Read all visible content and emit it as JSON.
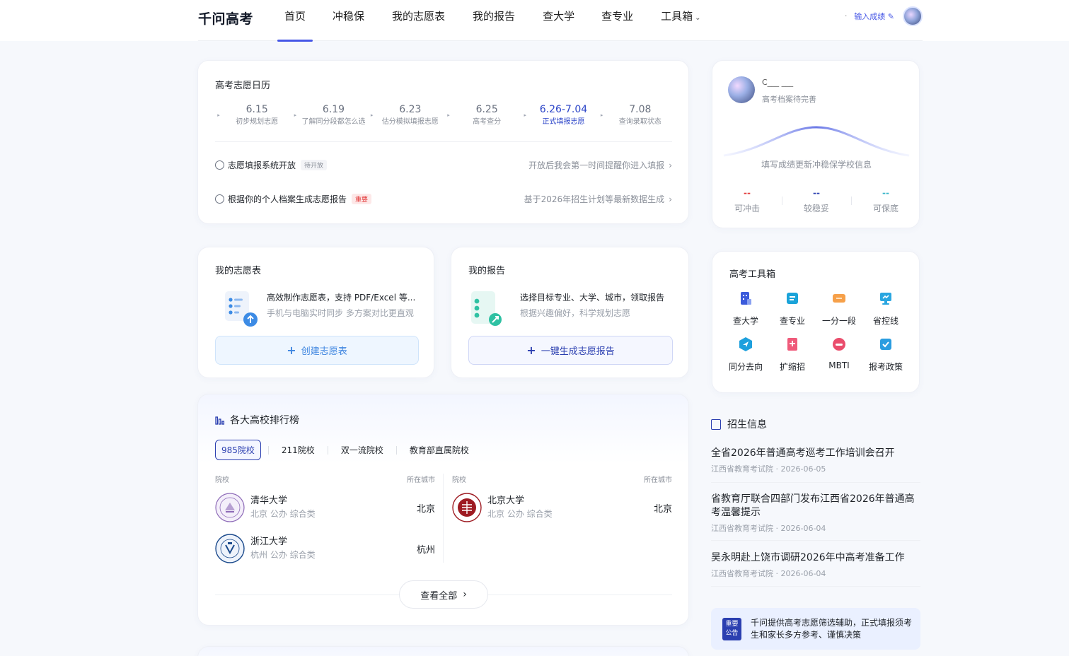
{
  "header": {
    "logo": "千问高考",
    "nav": [
      "首页",
      "冲稳保",
      "我的志愿表",
      "我的报告",
      "查大学",
      "查专业",
      "工具箱"
    ],
    "active_nav": "首页",
    "input_score": "输入成绩"
  },
  "calendar": {
    "title": "高考志愿日历",
    "items": [
      {
        "date": "6.15",
        "desc": "初步规划志愿"
      },
      {
        "date": "6.19",
        "desc": "了解同分段都怎么选"
      },
      {
        "date": "6.23",
        "desc": "估分模拟填报志愿"
      },
      {
        "date": "6.25",
        "desc": "高考查分"
      },
      {
        "date": "6.26-7.04",
        "desc": "正式填报志愿"
      },
      {
        "date": "7.08",
        "desc": "查询录取状态"
      }
    ],
    "current_index": 4,
    "line1": {
      "label": "志愿填报系统开放",
      "tag": "待开放",
      "right": "开放后我会第一时间提醒你进入填报"
    },
    "line2": {
      "label": "根据你的个人档案生成志愿报告",
      "tag": "重要",
      "right": "基于2026年招生计划等最新数据生成"
    }
  },
  "profile": {
    "name": "C___ ___",
    "subtitle": "高考档案待完善",
    "hint": "填写成绩更新冲稳保学校信息",
    "stats": [
      {
        "value": "--",
        "label": "可冲击",
        "color": "#e23b3b"
      },
      {
        "value": "--",
        "label": "较稳妥",
        "color": "#2b3fb0"
      },
      {
        "value": "--",
        "label": "可保底",
        "color": "#38b6c9"
      }
    ]
  },
  "mylist": {
    "title": "我的志愿表",
    "line1": "高效制作志愿表，支持 PDF/Excel 等...",
    "line2": "手机与电脑实时同步 多方案对比更直观",
    "button": "创建志愿表"
  },
  "myreport": {
    "title": "我的报告",
    "line1": "选择目标专业、大学、城市，领取报告",
    "line2": "根据兴趣偏好，科学规划志愿",
    "button": "一键生成志愿报告"
  },
  "toolbox": {
    "title": "高考工具箱",
    "tools": [
      {
        "label": "查大学",
        "icon": "building-icon",
        "color": "#3b5bdb"
      },
      {
        "label": "查专业",
        "icon": "book-icon",
        "color": "#1aa3d9"
      },
      {
        "label": "一分一段",
        "icon": "ruler-icon",
        "color": "#f6a049"
      },
      {
        "label": "省控线",
        "icon": "monitor-icon",
        "color": "#2aa6e0"
      },
      {
        "label": "同分去向",
        "icon": "navigate-icon",
        "color": "#1ea0dd"
      },
      {
        "label": "扩缩招",
        "icon": "document-plus-icon",
        "color": "#ef5a7a"
      },
      {
        "label": "MBTI",
        "icon": "face-icon",
        "color": "#ea4d6c"
      },
      {
        "label": "报考政策",
        "icon": "checkbox-icon",
        "color": "#2a9de0"
      }
    ]
  },
  "ranking": {
    "title": "各大高校排行榜",
    "tabs": [
      "985院校",
      "211院校",
      "双一流院校",
      "教育部直属院校"
    ],
    "active_tab": 0,
    "col_school": "院校",
    "col_city": "所在城市",
    "left": [
      {
        "name": "清华大学",
        "meta": "北京 公办 综合类",
        "city": "北京"
      },
      {
        "name": "浙江大学",
        "meta": "杭州 公办 综合类",
        "city": "杭州"
      }
    ],
    "right": [
      {
        "name": "北京大学",
        "meta": "北京 公办 综合类",
        "city": "北京"
      }
    ],
    "view_all": "查看全部"
  },
  "news": {
    "title": "招生信息",
    "items": [
      {
        "head": "全省2026年普通高考巡考工作培训会召开",
        "meta": "江西省教育考试院 · 2026-06-05"
      },
      {
        "head": "省教育厅联合四部门发布江西省2026年普通高考温馨提示",
        "meta": "江西省教育考试院 · 2026-06-04"
      },
      {
        "head": "吴永明赴上饶市调研2026年中高考准备工作",
        "meta": "江西省教育考试院 · 2026-06-04"
      }
    ],
    "notice_badge_1": "重要",
    "notice_badge_2": "公告",
    "notice_text": "千问提供高考志愿筛选辅助，正式填报须考生和家长多方参考、谨慎决策"
  }
}
